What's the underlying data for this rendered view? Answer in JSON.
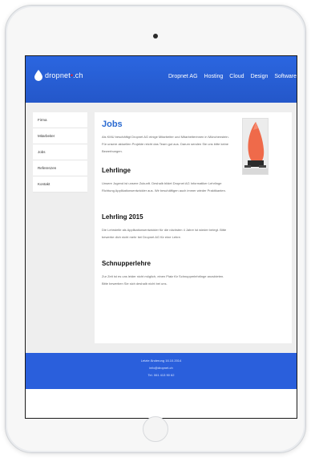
{
  "header": {
    "logo_text": "dropnet",
    "logo_suffix": ".ch",
    "nav": [
      "Dropnet AG",
      "Hosting",
      "Cloud",
      "Design",
      "Software"
    ]
  },
  "sidebar": {
    "items": [
      "Firma",
      "Mitarbeiter",
      "Jobs",
      "Referenzen",
      "Kontakt"
    ]
  },
  "content": {
    "title": "Jobs",
    "intro": "Als KMU beschäftigt Dropnet AG einige Mitarbeiter und Mitarbeiterinnen in Münchenstein. Für unsere aktuellen Projekte reicht das Team gut aus. Darum senden Sie uns bitte keine Bewerbungen.",
    "section1_title": "Lehrlinge",
    "section1_text": "Unsere Jugend ist unsere Zukunft. Deshalb bildet Dropnet AG Informatiker Lehrlinge Richtung Applikationsentwickler aus. Wir beschäftigen auch immer wieder Praktikanten.",
    "section2_title": "Lehrling 2015",
    "section2_text": "Die Lehrstelle als Applikationsentwickler für die nächsten 4 Jahre ist wieder belegt. Bitte bewerbe dich nicht mehr bei Dropnet AG für eine Lehre.",
    "section3_title": "Schnupperlehre",
    "section3_text": "Zur Zeit ist es uns leider nicht möglich, einen Platz für Schnupperlehrlinge anzubieten. Bitte bewerben Sie sich deshalb nicht bei uns."
  },
  "footer": {
    "line1": "Letzte Änderung 16.10.2014",
    "line2": "info@dropnet.ch",
    "line3": "Tel. 061 413 90 62"
  },
  "colors": {
    "header_blue": "#2b66e0",
    "title_blue": "#2a6ad1",
    "logo_dot_red": "#e8262a"
  }
}
